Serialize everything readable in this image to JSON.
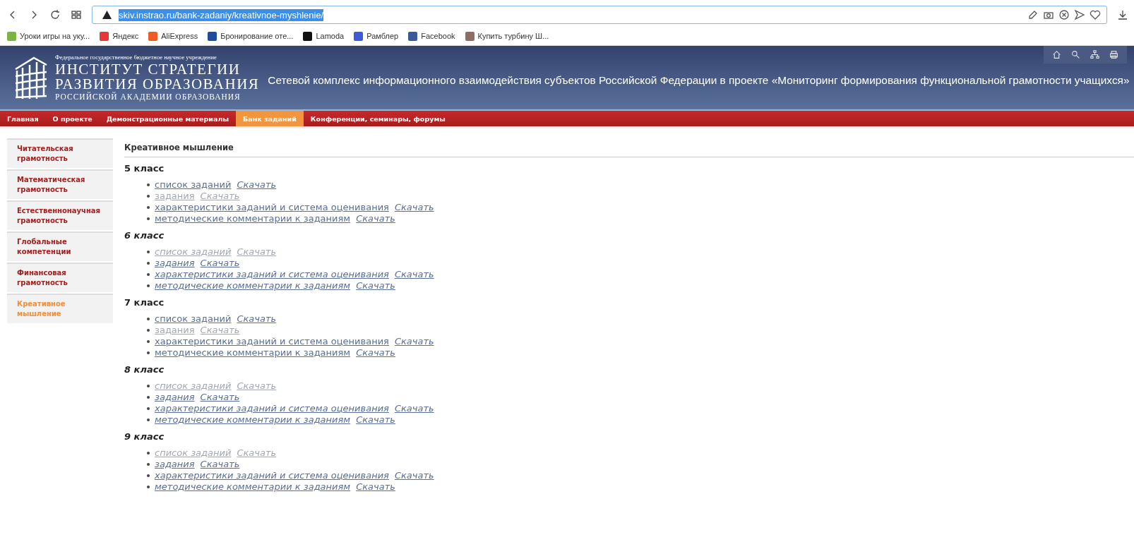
{
  "browser": {
    "url": "skiv.instrao.ru/bank-zadaniy/kreativnoe-myshlenie/",
    "bookmarks": [
      "Уроки игры на уку...",
      "Яндекс",
      "AliExpress",
      "Бронирование оте...",
      "Lamoda",
      "Рамблер",
      "Facebook",
      "Купить турбину Ш..."
    ]
  },
  "header": {
    "org_line": "Федеральное государственное бюджетное научное учреждение",
    "name_line1": "ИНСТИТУТ СТРАТЕГИИ",
    "name_line2": "РАЗВИТИЯ ОБРАЗОВАНИЯ",
    "name_line3": "РОССИЙСКОЙ АКАДЕМИИ ОБРАЗОВАНИЯ",
    "title": "Сетевой комплекс информационного взаимодействия субъектов Российской Федерации в проекте «Мониторинг формирования функциональной грамотности учащихся»"
  },
  "nav": [
    {
      "label": "Главная",
      "selected": false
    },
    {
      "label": "О проекте",
      "selected": false
    },
    {
      "label": "Демонстрационные материалы",
      "selected": false
    },
    {
      "label": "Банк заданий",
      "selected": true
    },
    {
      "label": "Конференции, семинары, форумы",
      "selected": false
    }
  ],
  "sidebar": [
    {
      "label": "Читательская грамотность",
      "selected": false
    },
    {
      "label": "Математическая грамотность",
      "selected": false
    },
    {
      "label": "Естественнонаучная грамотность",
      "selected": false
    },
    {
      "label": "Глобальные компетенции",
      "selected": false
    },
    {
      "label": "Финансовая грамотность",
      "selected": false
    },
    {
      "label": "Креативное мышление",
      "selected": true
    }
  ],
  "section_title": "Креативное мышление",
  "grades": [
    {
      "title": "5 класс",
      "italic": false,
      "items": [
        {
          "label": "список заданий",
          "download": "Скачать",
          "disabled": false
        },
        {
          "label": "задания",
          "download": "Скачать",
          "disabled": true
        },
        {
          "label": "характеристики заданий и система оценивания",
          "download": "Скачать",
          "disabled": false
        },
        {
          "label": "методические комментарии к заданиям",
          "download": "Скачать",
          "disabled": false
        }
      ]
    },
    {
      "title": "6 класс",
      "italic": true,
      "items": [
        {
          "label": "список заданий",
          "download": "Скачать",
          "disabled": true
        },
        {
          "label": "задания",
          "download": "Скачать",
          "disabled": false
        },
        {
          "label": "характеристики заданий и система оценивания",
          "download": "Скачать",
          "disabled": false
        },
        {
          "label": "методические комментарии к заданиям",
          "download": "Скачать",
          "disabled": false
        }
      ]
    },
    {
      "title": "7 класс",
      "italic": false,
      "items": [
        {
          "label": "список заданий",
          "download": "Скачать",
          "disabled": false
        },
        {
          "label": "задания",
          "download": "Скачать",
          "disabled": true
        },
        {
          "label": "характеристики заданий и система оценивания",
          "download": "Скачать",
          "disabled": false
        },
        {
          "label": "методические комментарии к заданиям",
          "download": "Скачать",
          "disabled": false
        }
      ]
    },
    {
      "title": "8 класс",
      "italic": true,
      "items": [
        {
          "label": "список заданий",
          "download": "Скачать",
          "disabled": true
        },
        {
          "label": "задания",
          "download": "Скачать",
          "disabled": false
        },
        {
          "label": "характеристики заданий и система оценивания",
          "download": "Скачать",
          "disabled": false
        },
        {
          "label": "методические комментарии к заданиям",
          "download": "Скачать",
          "disabled": false
        }
      ]
    },
    {
      "title": "9 класс",
      "italic": true,
      "items": [
        {
          "label": "список заданий",
          "download": "Скачать",
          "disabled": true
        },
        {
          "label": "задания",
          "download": "Скачать",
          "disabled": false
        },
        {
          "label": "характеристики заданий и система оценивания",
          "download": "Скачать",
          "disabled": false
        },
        {
          "label": "методические комментарии к заданиям",
          "download": "Скачать",
          "disabled": false
        }
      ]
    }
  ]
}
